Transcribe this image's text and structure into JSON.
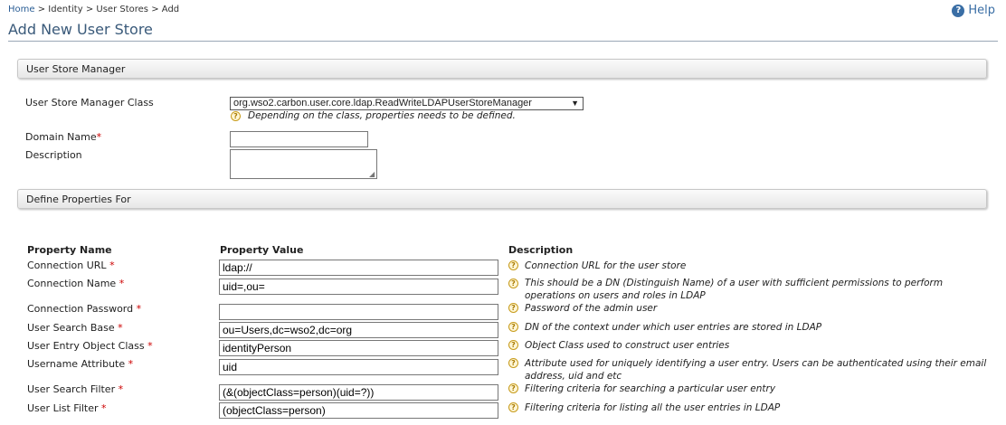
{
  "breadcrumb": [
    "Home",
    "Identity",
    "User Stores",
    "Add"
  ],
  "breadcrumb_sep": ">",
  "help_label": "Help",
  "page_title": "Add New User Store",
  "section_manager": "User Store Manager",
  "manager_class": {
    "label": "User Store Manager Class",
    "selected": "org.wso2.carbon.user.core.ldap.ReadWriteLDAPUserStoreManager",
    "hint": "Depending on the class, properties needs to be defined."
  },
  "domain": {
    "label": "Domain Name",
    "required": "*",
    "value": ""
  },
  "description": {
    "label": "Description",
    "value": ""
  },
  "section_properties": "Define Properties For",
  "table_headers": {
    "name": "Property Name",
    "value": "Property Value",
    "description": "Description"
  },
  "properties": [
    {
      "name": "Connection URL",
      "value": "ldap://",
      "desc": "Connection URL for the user store"
    },
    {
      "name": "Connection Name",
      "value": "uid=,ou=",
      "desc": "This should be a DN (Distinguish Name) of a user with sufficient permissions to perform operations on users and roles in LDAP"
    },
    {
      "name": "Connection Password",
      "value": "",
      "desc": "Password of the admin user"
    },
    {
      "name": "User Search Base",
      "value": "ou=Users,dc=wso2,dc=org",
      "desc": "DN of the context under which user entries are stored in LDAP"
    },
    {
      "name": "User Entry Object Class",
      "value": "identityPerson",
      "desc": "Object Class used to construct user entries"
    },
    {
      "name": "Username Attribute",
      "value": "uid",
      "desc": "Attribute used for uniquely identifying a user entry. Users can be authenticated using their email address, uid and etc"
    },
    {
      "name": "User Search Filter",
      "value": "(&(objectClass=person)(uid=?))",
      "desc": "Filtering criteria for searching a particular user entry"
    },
    {
      "name": "User List Filter",
      "value": "(objectClass=person)",
      "desc": "Filtering criteria for listing all the user entries in LDAP"
    }
  ],
  "required_mark": "*",
  "colors": {
    "title": "#3a5a7a",
    "link": "#2a5d95",
    "required": "#cc0000",
    "help_icon": "#3a6ea5"
  },
  "icons": {
    "help": "question-circle-icon",
    "hint": "question-mark-icon",
    "dropdown": "chevron-down-icon"
  }
}
